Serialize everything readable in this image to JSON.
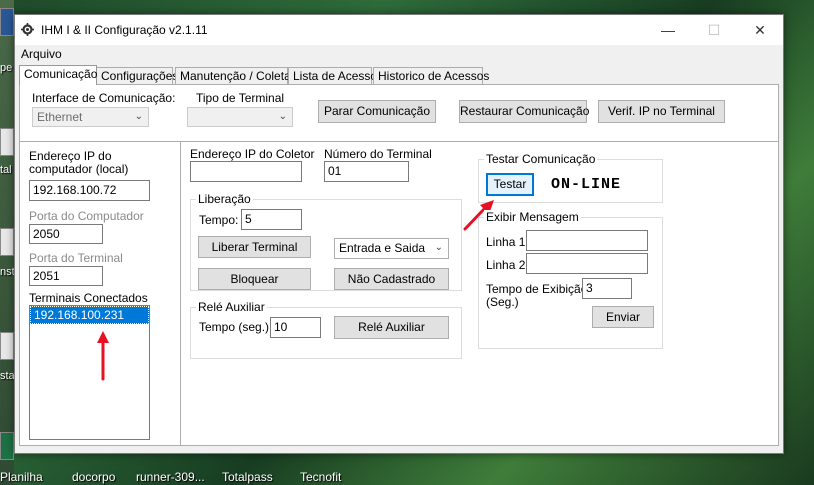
{
  "window": {
    "title": "IHM I & II Configuração v2.1.11"
  },
  "menu": {
    "items": [
      "Arquivo"
    ]
  },
  "tabs": [
    "Comunicação",
    "Configurações",
    "Manutenção / Coleta",
    "Lista de Acesso",
    "Historico de Acessos"
  ],
  "top": {
    "interface_label": "Interface de Comunicação:",
    "interface_value": "Ethernet",
    "terminal_type_label": "Tipo de Terminal",
    "terminal_type_value": "",
    "btn_stop": "Parar Comunicação",
    "btn_restore": "Restaurar Comunicação",
    "btn_verify": "Verif. IP no Terminal"
  },
  "left": {
    "ip_label_1": "Endereço IP do",
    "ip_label_2": "computador (local)",
    "ip_value": "192.168.100.72",
    "port_pc_label": "Porta do Computador",
    "port_pc_value": "2050",
    "port_term_label": "Porta do Terminal",
    "port_term_value": "2051",
    "connected_label": "Terminais Conectados",
    "connected_items": [
      "192.168.100.231"
    ]
  },
  "collector": {
    "ip_label": "Endereço IP do Coletor",
    "ip_value": "",
    "terminal_num_label": "Número do Terminal",
    "terminal_num_value": "01"
  },
  "release": {
    "group_title": "Liberação",
    "time_label": "Tempo:",
    "time_value": "5",
    "btn_release": "Liberar Terminal",
    "direction_value": "Entrada e Saida",
    "btn_block": "Bloquear",
    "btn_not_registered": "Não Cadastrado"
  },
  "relay": {
    "group_title": "Relé Auxiliar",
    "time_label": "Tempo (seg.)",
    "time_value": "10",
    "btn_relay": "Relé Auxiliar"
  },
  "test": {
    "group_title": "Testar Comunicação",
    "btn_test": "Testar",
    "status": "ON-LINE"
  },
  "message": {
    "group_title": "Exibir Mensagem",
    "line1_label": "Linha 1",
    "line1_value": "",
    "line2_label": "Linha 2",
    "line2_value": "",
    "display_time_label_1": "Tempo de Exibição",
    "display_time_label_2": "(Seg.)",
    "display_time_value": "3",
    "btn_send": "Enviar"
  },
  "taskbar": {
    "items": [
      "Planilha",
      "docorpo",
      "runner-309...",
      "Totalpass",
      "Tecnofit"
    ]
  },
  "desktop": {
    "labels": [
      "pe",
      "tal",
      "nst",
      "sta"
    ]
  },
  "colors": {
    "accent": "#0078d7",
    "arrow": "#e81123"
  }
}
